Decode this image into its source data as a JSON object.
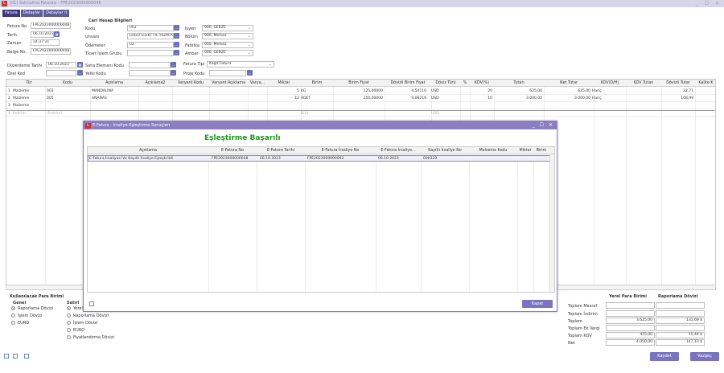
{
  "window": {
    "title": "(01) Satınalma Faturası - FPE2023000000048"
  },
  "tabs": [
    {
      "label": "Fatura"
    },
    {
      "label": "Detaylar"
    },
    {
      "label": "Detaylar II"
    }
  ],
  "header": {
    "fatura_no_label": "Fatura No.",
    "fatura_no": "FPE2023000000048",
    "tarih_label": "Tarih",
    "tarih": "06.10.2023",
    "zaman_label": "Zaman",
    "zaman": "14:37:31",
    "belge_no_label": "Belge No.",
    "belge_no": "FPE2023000000048",
    "cari_title": "Cari Hesap Bilgileri",
    "kodu_label": "Kodu",
    "kodu": "002",
    "unvani_label": "Unvanı",
    "unvani": "LOGO ELEKT.TİC.HİZM.A",
    "odemeler_label": "Ödemeler",
    "odemeler": "02",
    "ticari_label": "Ticari İşlem Grubu",
    "ticari": "",
    "isyeri_label": "İşyeri",
    "isyeri": "000, GEBZE",
    "bolum_label": "Bölüm",
    "bolum": "000, Merkez",
    "fabrika_label": "Fabrika",
    "fabrika": "000, Merkez",
    "ambar_label": "Ambar",
    "ambar": "000, GEBZE",
    "duzenleme_label": "Düzenleme Tarihi",
    "duzenleme": "06.10.2023",
    "satis_label": "Satış Elemanı Kodu",
    "satis": "",
    "fatura_tipi_label": "Fatura Tipi",
    "fatura_tipi": "Kağıt Fatura",
    "ozel_kod_label": "Özel Kod",
    "ozel_kod": "",
    "yetki_label": "Yetki Kodu",
    "yetki": "",
    "proje_label": "Proje Kodu",
    "proje": ""
  },
  "grid": {
    "columns": [
      "Tür",
      "Kodu",
      "Açıklama",
      "Açıklama2",
      "Varyant Kodu",
      "Varyant Açıklama",
      "Varya...",
      "Miktar",
      "Birim",
      "Birim Fiyat",
      "Dövizli Birim Fiyat",
      "Döviz Türü",
      "%",
      "KDV(%)",
      "Tutarı",
      "Net Tutar",
      "KDV(D/H)",
      "KDV Tutarı",
      "Dövizli Tutar",
      "Kalite K"
    ],
    "rows": [
      {
        "no": "1",
        "tur": "Malzeme",
        "kodu": "003",
        "aciklama": "MANDALİNA",
        "miktar": "5",
        "birim": "KG",
        "birim_fiyat": "125,00000",
        "doviz_bf": "4,54110",
        "doviz": "USD",
        "kdv": "20",
        "tutar": "625,00",
        "net": "625,00",
        "kdvdh": "Hariç",
        "dov_tutar": "22,71"
      },
      {
        "no": "2",
        "tur": "Malzeme",
        "kodu": "005",
        "aciklama": "ANANAS",
        "miktar": "12",
        "birim": "ADET",
        "birim_fiyat": "250,00000",
        "doviz_bf": "9,08219",
        "doviz": "USD",
        "kdv": "10",
        "tutar": "3.000,00",
        "net": "3.000,00",
        "kdvdh": "Hariç",
        "dov_tutar": "108,99"
      },
      {
        "no": "3",
        "tur": "Malzeme",
        "kodu": "",
        "aciklama": "",
        "miktar": "",
        "birim": "",
        "birim_fiyat": "",
        "doviz_bf": "",
        "doviz": "",
        "kdv": "",
        "tutar": "",
        "net": "",
        "kdvdh": "",
        "dov_tutar": ""
      },
      {
        "no": "4",
        "tur": "İndirim",
        "kodu": "(İndirim)",
        "aciklama": "",
        "miktar": "",
        "birim": "Brüt",
        "birim_fiyat": "",
        "doviz_bf": "",
        "doviz": "USD",
        "kdv": "",
        "tutar": "",
        "net": "",
        "kdvdh": "",
        "dov_tutar": ""
      }
    ]
  },
  "modal": {
    "title": "E-Fatura - İrsaliye Eşleştirme Sonuçları",
    "heading": "Eşleştirme Başarılı",
    "columns": [
      "Açıklama",
      "E-Fatura No",
      "E-Fatura Tarihi",
      "E-Fatura İrsaliye No",
      "E-Fatura İrsaliye...",
      "Kayıtlı İrsaliye No",
      "Malzeme Kodu",
      "Miktar",
      "Birim"
    ],
    "rows": [
      {
        "aciklama": "E-Fatura İrsaliyesi Ve Kayıtlı İrsaliye Eşleştirildi",
        "efatura_no": "FPE2023000000048",
        "efatura_tarih": "06.10.2023",
        "irsaliye_no": "FPE2023000000092",
        "irsaliye_tarih": "06.10.2023",
        "kayitli_no": "000229",
        "malzeme": "",
        "miktar": "",
        "birim": ""
      }
    ],
    "close_label": "Kapat"
  },
  "currency": {
    "title": "Kullanılacak Para Birimi",
    "genel_label": "Genel",
    "genel_options": [
      "Raporlama Dövizi",
      "İşlem Dövizi",
      "EURO"
    ],
    "genel_selected": 0,
    "satir_label": "Satırl",
    "satir_options": [
      "Yerel",
      "Raporlama Dövizi",
      "İşlem Dövizi",
      "EURO",
      "Fiyatlandırma Dövizi"
    ],
    "satir_selected": 0
  },
  "totals": {
    "col1": "Yerel Para Birimi",
    "col2": "Raporlama Dövizi",
    "rows": [
      {
        "label": "Toplam Masraf",
        "v1": "",
        "v2": ""
      },
      {
        "label": "Toplam İndirim",
        "v1": "",
        "v2": ""
      },
      {
        "label": "Toplam",
        "v1": "3.625,00",
        "v2": "131,69 $"
      },
      {
        "label": "Toplam Ek Vergi",
        "v1": "",
        "v2": ""
      },
      {
        "label": "Toplam KDV",
        "v1": "425,00",
        "v2": "15,44 $"
      },
      {
        "label": "Net",
        "v1": "4.050,00",
        "v2": "147,13 $"
      }
    ]
  },
  "buttons": {
    "save": "Kaydet",
    "cancel": "Vazgeç"
  },
  "colors": {
    "accent": "#7a74c0",
    "tab": "#5d5c9a",
    "success": "#1c9a1c"
  }
}
